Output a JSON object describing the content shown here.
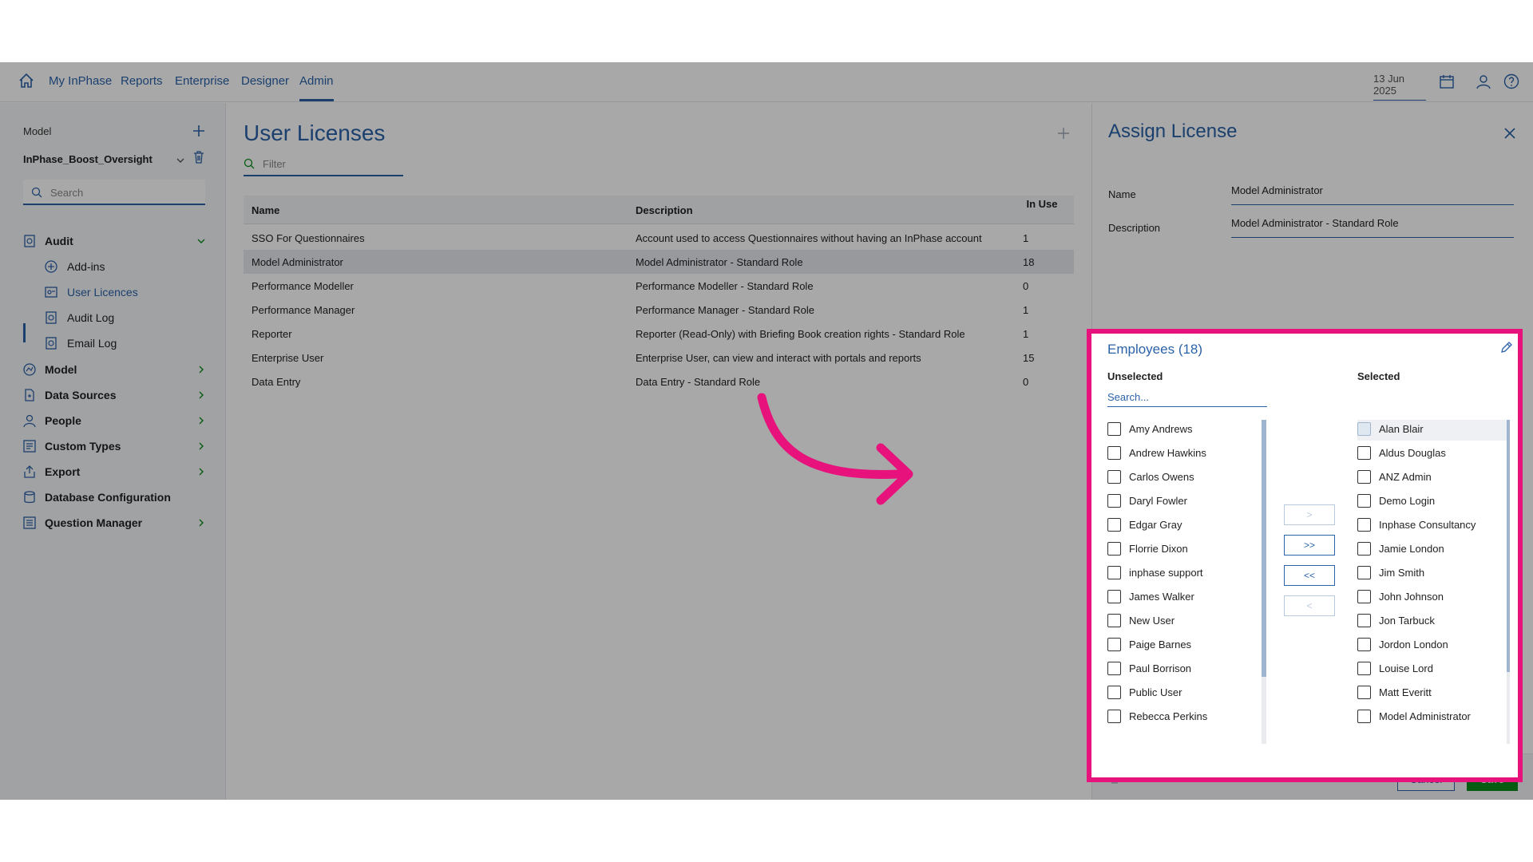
{
  "nav": {
    "links": [
      "My InPhase",
      "Reports",
      "Enterprise",
      "Designer",
      "Admin"
    ],
    "active": "Admin",
    "date": "13 Jun 2025"
  },
  "sidebar": {
    "model_label": "Model",
    "model_name": "InPhase_Boost_Oversight",
    "search_placeholder": "Search",
    "items": [
      {
        "label": "Audit",
        "icon": "audit-icon",
        "expanded": true
      },
      {
        "label": "Model",
        "icon": "model-icon"
      },
      {
        "label": "Data Sources",
        "icon": "data-sources-icon"
      },
      {
        "label": "People",
        "icon": "person-icon"
      },
      {
        "label": "Custom Types",
        "icon": "custom-types-icon"
      },
      {
        "label": "Export",
        "icon": "export-icon"
      },
      {
        "label": "Database Configuration",
        "icon": "database-icon"
      },
      {
        "label": "Question Manager",
        "icon": "question-manager-icon"
      }
    ],
    "sub_items": [
      {
        "label": "Add-ins",
        "icon": "add-icon"
      },
      {
        "label": "User Licences",
        "icon": "licence-icon",
        "active": true
      },
      {
        "label": "Audit Log",
        "icon": "audit-log-icon"
      },
      {
        "label": "Email Log",
        "icon": "email-log-icon"
      }
    ]
  },
  "main": {
    "title": "User Licenses",
    "filter_placeholder": "Filter",
    "columns": [
      "Name",
      "Description",
      "In Use"
    ],
    "rows": [
      {
        "name": "SSO For Questionnaires",
        "description": "Account used to access Questionnaires without having an InPhase account",
        "in_use": "1"
      },
      {
        "name": "Model Administrator",
        "description": "Model Administrator - Standard Role",
        "in_use": "18",
        "selected": true
      },
      {
        "name": "Performance Modeller",
        "description": "Performance Modeller - Standard Role",
        "in_use": "0"
      },
      {
        "name": "Performance Manager",
        "description": "Performance Manager - Standard Role",
        "in_use": "1"
      },
      {
        "name": "Reporter",
        "description": "Reporter (Read-Only) with Briefing Book creation rights - Standard Role",
        "in_use": "1"
      },
      {
        "name": "Enterprise User",
        "description": "Enterprise User, can view and interact with portals and reports",
        "in_use": "15"
      },
      {
        "name": "Data Entry",
        "description": "Data Entry - Standard Role",
        "in_use": "0"
      }
    ]
  },
  "detail": {
    "title": "Assign License",
    "name_label": "Name",
    "name_value": "Model Administrator",
    "description_label": "Description",
    "description_value": "Model Administrator - Standard Role",
    "cancel_label": "Cancel",
    "save_label": "Save",
    "save_color": "#0b8a19"
  },
  "employees": {
    "title": "Employees (18)",
    "unselected_header": "Unselected",
    "selected_header": "Selected",
    "search_placeholder": "Search...",
    "unselected": [
      "Amy Andrews",
      "Andrew Hawkins",
      "Carlos Owens",
      "Daryl Fowler",
      "Edgar Gray",
      "Florrie Dixon",
      "inphase support",
      "James Walker",
      "New User",
      "Paige Barnes",
      "Paul Borrison",
      "Public User",
      "Rebecca Perkins"
    ],
    "selected": [
      "Alan Blair",
      "Aldus Douglas",
      "ANZ Admin",
      "Demo Login",
      "Inphase Consultancy",
      "Jamie London",
      "Jim Smith",
      "John Johnson",
      "Jon Tarbuck",
      "Jordon London",
      "Louise Lord",
      "Matt Everitt",
      "Model Administrator"
    ],
    "move_buttons": [
      ">",
      ">>",
      "<<",
      "<"
    ],
    "highlight_color": "#e8127c"
  }
}
